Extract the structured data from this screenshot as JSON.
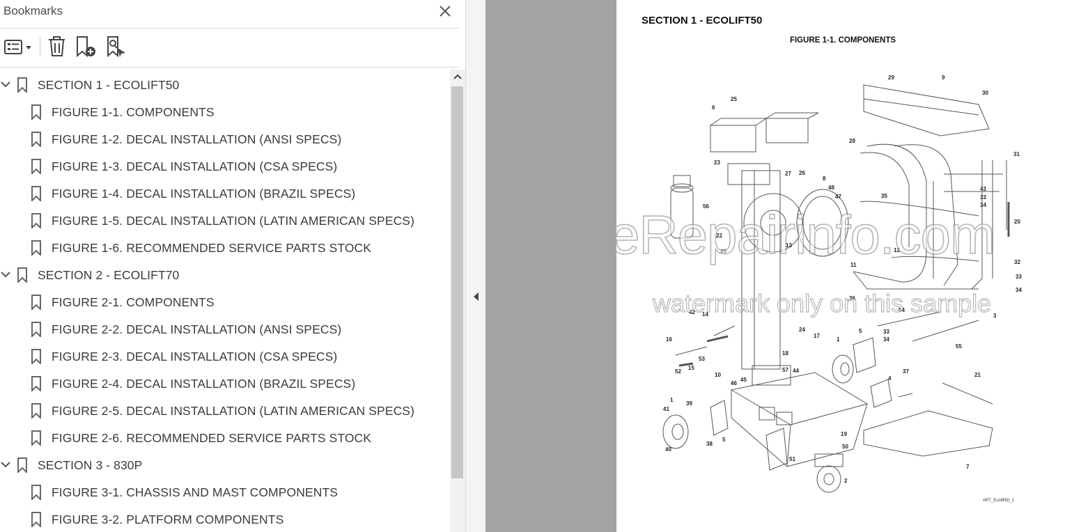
{
  "bookmarks_panel": {
    "title": "Bookmarks",
    "toolbar": {
      "options_icon": "list-options-icon",
      "delete_icon": "trash-icon",
      "add_icon": "add-bookmark-icon",
      "find_icon": "find-bookmark-icon"
    },
    "sections": [
      {
        "label": "SECTION 1 - ECOLIFT50",
        "expanded": true,
        "items": [
          "FIGURE 1-1. COMPONENTS",
          "FIGURE 1-2. DECAL INSTALLATION (ANSI SPECS)",
          "FIGURE 1-3. DECAL INSTALLATION (CSA SPECS)",
          "FIGURE 1-4. DECAL INSTALLATION (BRAZIL SPECS)",
          "FIGURE 1-5. DECAL INSTALLATION (LATIN AMERICAN SPECS)",
          "FIGURE 1-6. RECOMMENDED SERVICE PARTS STOCK"
        ]
      },
      {
        "label": "SECTION 2 - ECOLIFT70",
        "expanded": true,
        "items": [
          "FIGURE 2-1. COMPONENTS",
          "FIGURE 2-2. DECAL INSTALLATION (ANSI SPECS)",
          "FIGURE 2-3. DECAL INSTALLATION (CSA SPECS)",
          "FIGURE 2-4. DECAL INSTALLATION (BRAZIL SPECS)",
          "FIGURE 2-5. DECAL INSTALLATION (LATIN AMERICAN SPECS)",
          "FIGURE 2-6. RECOMMENDED SERVICE PARTS STOCK"
        ]
      },
      {
        "label": "SECTION 3 - 830P",
        "expanded": true,
        "items": [
          "FIGURE 3-1. CHASSIS AND MAST COMPONENTS",
          "FIGURE 3-2. PLATFORM COMPONENTS"
        ]
      }
    ]
  },
  "document": {
    "section_heading": "SECTION 1 - ECOLIFT50",
    "figure_heading": "FIGURE 1-1. COMPONENTS",
    "art_code": "ART_Ecolift50_1",
    "watermark_main": "eRepairinfo.com",
    "watermark_sub": "watermark only on this sample",
    "callouts": [
      "1",
      "2",
      "3",
      "4",
      "5",
      "6",
      "7",
      "8",
      "9",
      "10",
      "11",
      "12",
      "13",
      "14",
      "15",
      "16",
      "17",
      "18",
      "19",
      "20",
      "21",
      "22",
      "23",
      "24",
      "25",
      "26",
      "27",
      "28",
      "29",
      "30",
      "31",
      "32",
      "33",
      "34",
      "35",
      "36",
      "37",
      "38",
      "39",
      "40",
      "41",
      "42",
      "43",
      "44",
      "45",
      "46",
      "47",
      "48",
      "49",
      "50",
      "51",
      "52",
      "53",
      "54",
      "55",
      "56",
      "57"
    ]
  },
  "colors": {
    "panel_bg": "#ffffff",
    "doc_bg": "#a3a3a3",
    "text": "#3b3b3b",
    "divider": "#d9d9d9",
    "scroll_thumb": "#c6c6c6"
  }
}
